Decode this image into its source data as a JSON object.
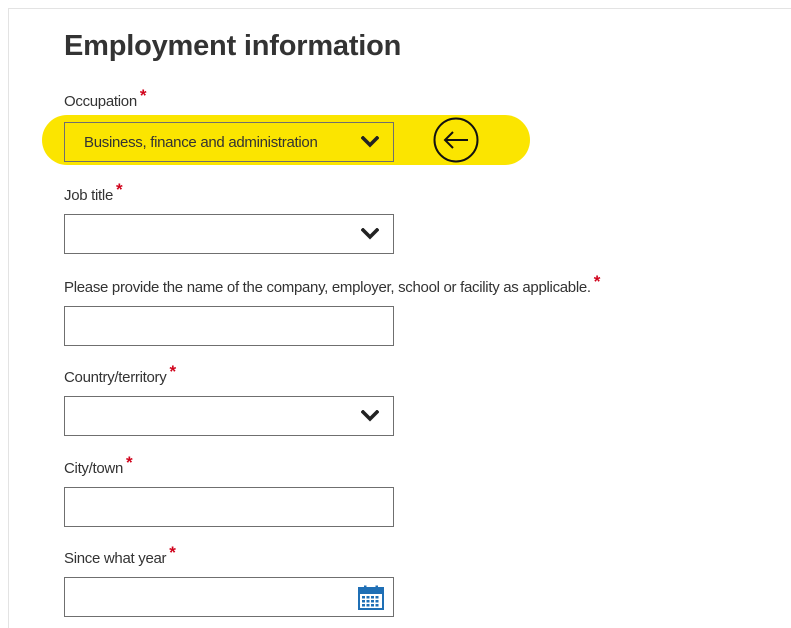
{
  "form": {
    "title": "Employment information",
    "required_marker": "*",
    "occupation": {
      "label": "Occupation",
      "value": "Business, finance and administration"
    },
    "job_title": {
      "label": "Job title",
      "value": ""
    },
    "company": {
      "label": "Please provide the name of the company, employer, school or facility as applicable.",
      "value": ""
    },
    "country": {
      "label": "Country/territory",
      "value": ""
    },
    "city": {
      "label": "City/town",
      "value": ""
    },
    "since_year": {
      "label": "Since what year",
      "value": ""
    }
  },
  "colors": {
    "highlight": "#fbe500",
    "required": "#d0021b",
    "calendar": "#1f6fb5",
    "text": "#333333"
  },
  "icons": {
    "dropdown": "chevron-down-icon",
    "pointer": "arrow-left-circle-icon",
    "date": "calendar-icon"
  }
}
